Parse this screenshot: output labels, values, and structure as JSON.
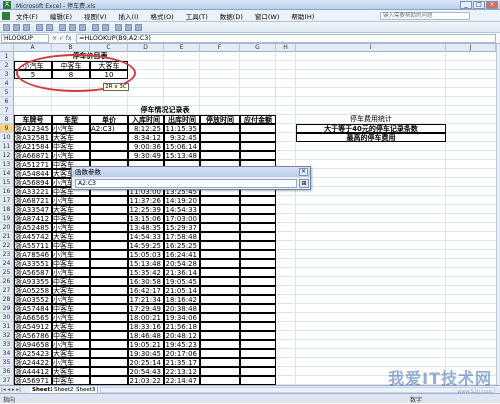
{
  "app": {
    "title": "Microsoft Excel - 停车费.xls",
    "icon": "excel-icon"
  },
  "window_controls": {
    "minimize": "_",
    "restore": "□",
    "close": "×"
  },
  "menu": [
    "文件(F)",
    "编辑(E)",
    "视图(V)",
    "插入(I)",
    "格式(O)",
    "工具(T)",
    "数据(D)",
    "窗口(W)",
    "帮助(H)"
  ],
  "help_search": {
    "placeholder": "键入需要帮助的问题"
  },
  "namebox": {
    "value": "HLOOKUP"
  },
  "formula": {
    "fx_label": "× ✓ fx",
    "value": "=HLOOKUP(B9,A2:C3)"
  },
  "column_headers": [
    "A",
    "B",
    "C",
    "D",
    "E",
    "F",
    "G",
    "H",
    "I",
    "J"
  ],
  "price_table": {
    "title": "停车价目表",
    "headers": [
      "小汽车",
      "中客车",
      "大客车"
    ],
    "values": [
      "5",
      "8",
      "10"
    ]
  },
  "selection_tip": "2R x 3C",
  "record_table": {
    "title": "停车情况记录表",
    "headers": [
      "车牌号",
      "车型",
      "单价",
      "入库时间",
      "出库时间",
      "停放时间",
      "应付金额"
    ],
    "rows": [
      [
        "浙A12345",
        "小汽车",
        "A2:C3)",
        "8:12:25",
        "11:15:35"
      ],
      [
        "浙A32581",
        "大客车",
        "",
        "8:34:12",
        "9:32:45"
      ],
      [
        "浙A21584",
        "中客车",
        "",
        "9:00:36",
        "15:06:14"
      ],
      [
        "浙A66871",
        "小汽车",
        "",
        "9:30:49",
        "15:13:48"
      ],
      [
        "浙A51271",
        "中客车",
        "",
        "",
        ""
      ],
      [
        "浙A54844",
        "大客车",
        "",
        "",
        ""
      ],
      [
        "浙A56894",
        "小汽车",
        "",
        "",
        ""
      ],
      [
        "浙A33221",
        "中客车",
        "",
        "11:03:00",
        "13:25:45"
      ],
      [
        "浙A68721",
        "小汽车",
        "",
        "11:37:26",
        "14:19:20"
      ],
      [
        "浙A33547",
        "大客车",
        "",
        "12:25:39",
        "14:54:33"
      ],
      [
        "浙A87412",
        "中客车",
        "",
        "13:15:06",
        "17:03:00"
      ],
      [
        "浙A52485",
        "小汽车",
        "",
        "13:48:35",
        "15:29:37"
      ],
      [
        "浙A45742",
        "大客车",
        "",
        "14:54:33",
        "17:58:48"
      ],
      [
        "浙A55711",
        "中客车",
        "",
        "14:59:25",
        "16:25:25"
      ],
      [
        "浙A78546",
        "小汽车",
        "",
        "15:05:03",
        "16:24:41"
      ],
      [
        "浙A33551",
        "中客车",
        "",
        "15:13:48",
        "20:54:28"
      ],
      [
        "浙A56587",
        "小汽车",
        "",
        "15:35:42",
        "21:36:14"
      ],
      [
        "浙A93355",
        "中客车",
        "",
        "16:30:58",
        "19:05:45"
      ],
      [
        "浙A05258",
        "大客车",
        "",
        "16:42:17",
        "21:05:14"
      ],
      [
        "浙A03552",
        "小汽车",
        "",
        "17:21:34",
        "18:16:42"
      ],
      [
        "浙A57484",
        "中客车",
        "",
        "17:29:49",
        "20:38:48"
      ],
      [
        "浙A66565",
        "小汽车",
        "",
        "18:00:21",
        "19:34:06"
      ],
      [
        "浙A54912",
        "大客车",
        "",
        "18:33:16",
        "21:56:18"
      ],
      [
        "浙A56786",
        "中客车",
        "",
        "18:46:48",
        "20:48:12"
      ],
      [
        "浙A94658",
        "小汽车",
        "",
        "19:05:21",
        "19:45:23"
      ],
      [
        "浙A25423",
        "大客车",
        "",
        "19:30:45",
        "20:17:06"
      ],
      [
        "浙A24422",
        "小汽车",
        "",
        "20:25:14",
        "21:35:17"
      ],
      [
        "浙A44412",
        "大客车",
        "",
        "20:54:43",
        "22:13:12"
      ],
      [
        "浙A56971",
        "中客车",
        "",
        "21:03:22",
        "22:14:47"
      ]
    ]
  },
  "stats": {
    "title": "停车费用统计",
    "rows": [
      "大于等于40元的停车记录条数",
      "最高的停车费用"
    ]
  },
  "dialog": {
    "title": "函数参数",
    "input_value": "A2:C3",
    "close": "×",
    "ref_button": "⊞"
  },
  "sheet_tabs": {
    "nav": "|◂ ◂ ▸ ▸|",
    "tabs": [
      "Sheet1",
      "Sheet2",
      "Sheet3"
    ],
    "active": "Sheet1"
  },
  "status": {
    "left": "指向",
    "right": "数字"
  },
  "watermark": {
    "text": "我爱IT技术网",
    "sub": "www.52ij.com"
  }
}
